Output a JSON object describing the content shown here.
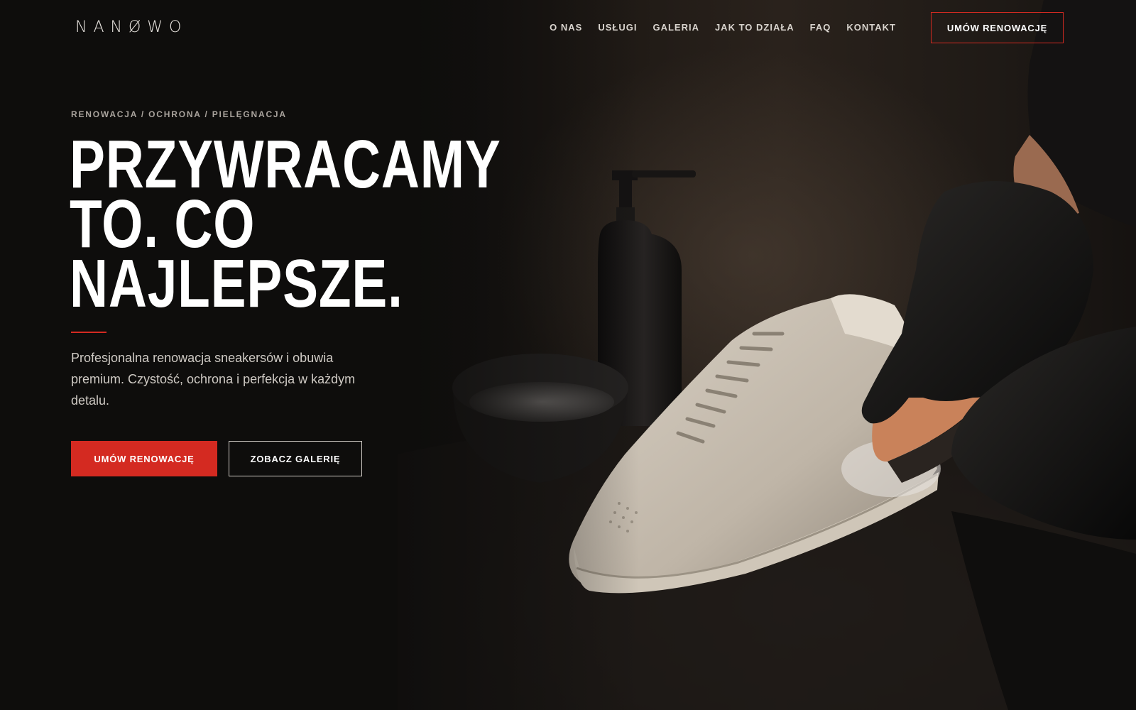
{
  "brand": {
    "logo": "NANØWO"
  },
  "nav": {
    "items": [
      "O NAS",
      "USŁUGI",
      "GALERIA",
      "JAK TO DZIAŁA",
      "FAQ",
      "KONTAKT"
    ],
    "cta": "UMÓW RENOWACJĘ"
  },
  "hero": {
    "kicker": "RENOWACJA / OCHRONA / PIELĘGNACJA",
    "headline": [
      "PRZYWRACAMY",
      "TO. CO",
      "NAJLEPSZE."
    ],
    "lead": "Profesjonalna renowacja sneakersów i obuwia premium. Czystość, ochrona i perfekcja w każdym detalu.",
    "primary_button": "UMÓW RENOWACJĘ",
    "secondary_button": "ZOBACZ GALERIĘ"
  },
  "colors": {
    "accent": "#d42a21",
    "background": "#0e0d0c",
    "text": "#ffffff"
  }
}
